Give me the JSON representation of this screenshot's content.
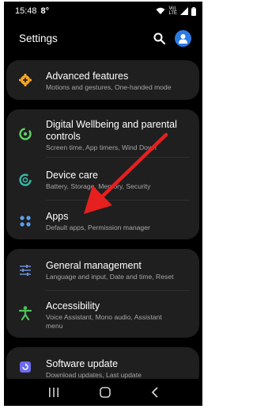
{
  "status": {
    "time": "15:48",
    "carrier_mark": "8°",
    "network_line1": "Vo)",
    "network_line2": "LTE"
  },
  "header": {
    "title": "Settings"
  },
  "items": {
    "advanced": {
      "title": "Advanced features",
      "subtitle": "Motions and gestures, One-handed mode"
    },
    "wellbeing": {
      "title_line1": "Digital Wellbeing and parental",
      "title_line2": "controls",
      "subtitle": "Screen time, App timers, Wind Down"
    },
    "devicecare": {
      "title": "Device care",
      "subtitle": "Battery, Storage, Memory, Security"
    },
    "apps": {
      "title": "Apps",
      "subtitle": "Default apps, Permission manager"
    },
    "general": {
      "title": "General management",
      "subtitle": "Language and input, Date and time, Reset"
    },
    "accessibility": {
      "title": "Accessibility",
      "subtitle_line1": "Voice Assistant, Mono audio, Assistant",
      "subtitle_line2": "menu"
    },
    "update": {
      "title": "Software update",
      "subtitle": "Download updates, Last update"
    }
  },
  "colors": {
    "advanced_icon": "#f5a623",
    "wellbeing_icon": "#5fd068",
    "devicecare_icon": "#38b7a6",
    "apps_icon": "#5aa0f2",
    "general_icon": "#6b8fd6",
    "accessibility_icon": "#4fc35a",
    "update_icon": "#6c6cf0",
    "annotation_arrow": "#e61f1f"
  },
  "icons": {
    "advanced": "gear-plus-icon",
    "wellbeing": "wellbeing-ring-icon",
    "devicecare": "device-care-icon",
    "apps": "four-dots-icon",
    "general": "sliders-icon",
    "accessibility": "person-icon",
    "update": "update-icon"
  }
}
